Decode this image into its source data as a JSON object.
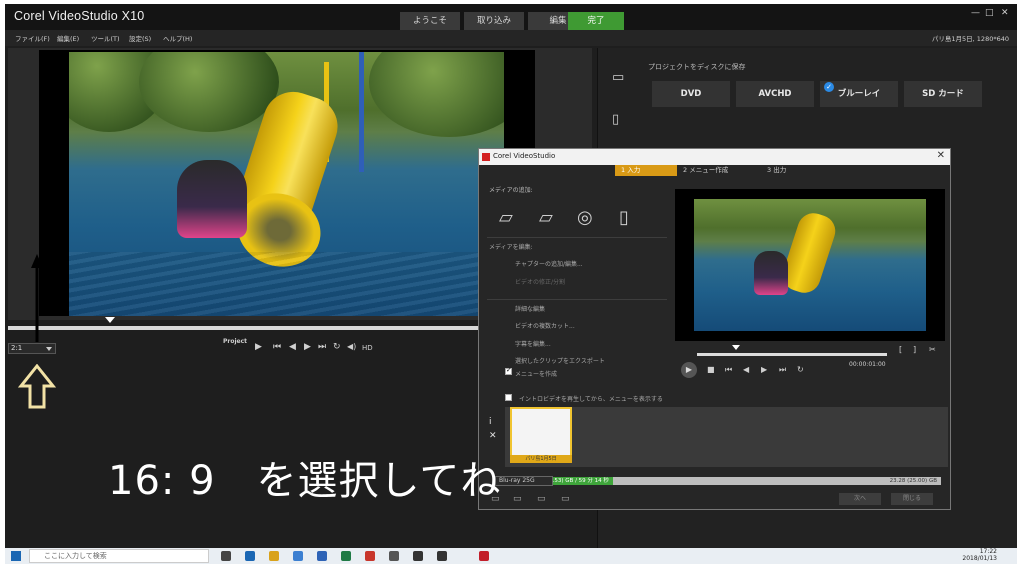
{
  "app": {
    "title": "Corel VideoStudio X10",
    "steps": [
      "ようこそ",
      "取り込み",
      "編集",
      "完了"
    ],
    "active_step": "完了",
    "window_controls": [
      "—",
      "□",
      "✕"
    ]
  },
  "menu": {
    "items": [
      "ファイル(F)",
      "編集(E)",
      "ツール(T)",
      "設定(S)",
      "ヘルプ(H)"
    ],
    "right_info": "パリ島1月5日, 1280*640"
  },
  "player": {
    "zoom_value": "2:1",
    "project_label": "Project",
    "hd_label": "HD"
  },
  "overlay": {
    "caption": "16: 9　を選択してね"
  },
  "output": {
    "section_title": "プロジェクトをディスクに保存",
    "formats": [
      "DVD",
      "AVCHD",
      "ブルーレイ",
      "SD カード"
    ],
    "selected_format": "ブルーレイ"
  },
  "dialog": {
    "title": "Corel VideoStudio",
    "close": "✕",
    "tabs": [
      "1 入力",
      "2 メニュー作成",
      "3 出力"
    ],
    "active_tab": "1 入力",
    "media_header": "メディアの追加:",
    "edit_header": "メディアを編集:",
    "chapter_add": "チャプターの追加/編集...",
    "clip_cut": "ビデオの修正/分割",
    "advanced": "詳細な編集",
    "multi_trim": "ビデオの複数カット...",
    "subtitle_edit": "字幕を編集...",
    "export_clip": "選択したクリップをエクスポート",
    "create_menu": "メニューを作成",
    "intro_option": "イントロビデオを再生してから、メニューを表示する",
    "timecode": "00:00:01:00",
    "thumb_label": "パリ島1月5日",
    "disc_select": "Blu-ray 25G",
    "progress_text": "4.53 (4.53) GB / 59 分 14 秒",
    "capacity_text": "23.28 (25.00) GB",
    "next_btn": "次へ",
    "close_btn": "閉じる"
  },
  "taskbar": {
    "search_placeholder": "ここに入力して検索",
    "time": "17:22",
    "date": "2018/01/13"
  },
  "colors": {
    "accent_green": "#3f9a33",
    "dialog_tab_orange": "#d99a16",
    "caption_white": "#ffffff"
  }
}
